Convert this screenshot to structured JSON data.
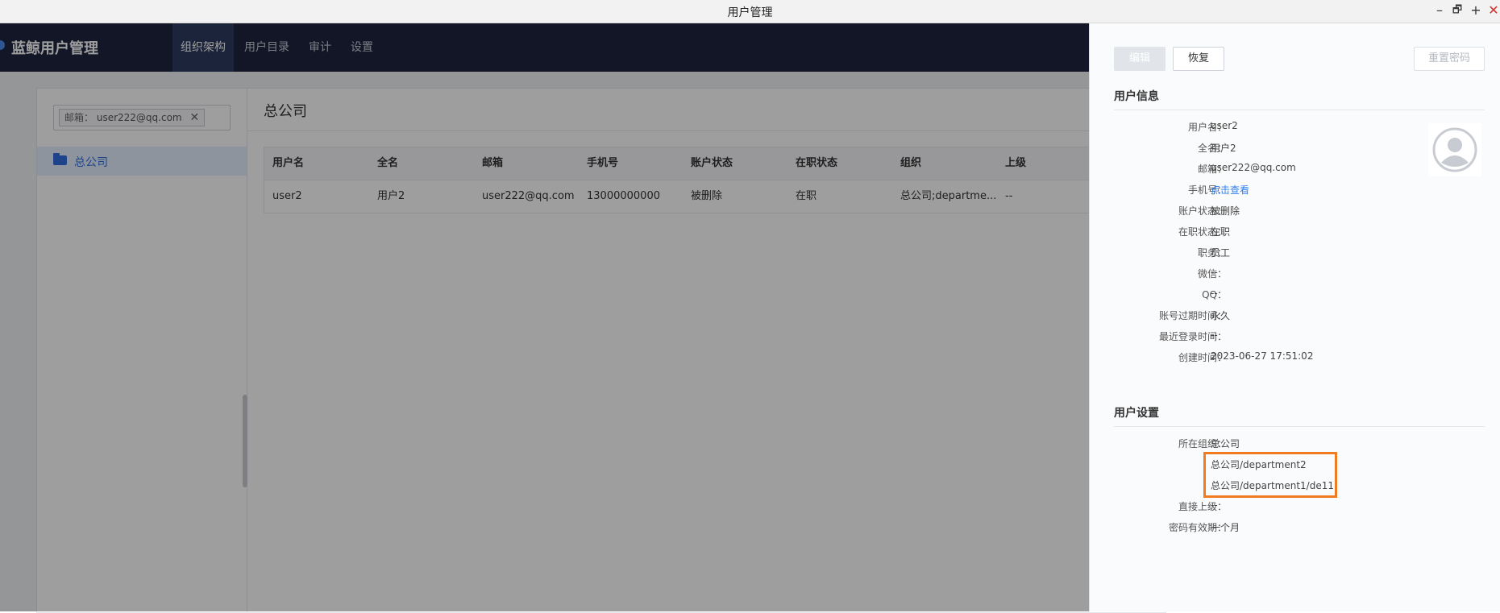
{
  "window": {
    "title": "用户管理",
    "controls": {
      "minimize": "–",
      "restore": "🗗",
      "maximize": "+",
      "close": "✕"
    }
  },
  "app": {
    "brand": "蓝鲸用户管理",
    "nav": [
      {
        "label": "组织架构",
        "active": true
      },
      {
        "label": "用户目录",
        "active": false
      },
      {
        "label": "审计",
        "active": false
      },
      {
        "label": "设置",
        "active": false
      }
    ],
    "search_tag": {
      "label": "邮箱：",
      "value": "user222@qq.com"
    },
    "tree": {
      "root": "总公司"
    },
    "main_title": "总公司",
    "table": {
      "headers": [
        "用户名",
        "全名",
        "邮箱",
        "手机号",
        "账户状态",
        "在职状态",
        "组织",
        "上级"
      ],
      "rows": [
        [
          "user2",
          "用户2",
          "user222@qq.com",
          "13000000000",
          "被删除",
          "在职",
          "总公司;departme...",
          "--"
        ]
      ]
    }
  },
  "drawer": {
    "buttons": {
      "edit": "编辑",
      "restore": "恢复",
      "reset_password": "重置密码"
    },
    "user_info_title": "用户信息",
    "user_info": [
      {
        "label": "用户名：",
        "value": "user2"
      },
      {
        "label": "全名：",
        "value": "用户2"
      },
      {
        "label": "邮箱：",
        "value": "user222@qq.com"
      },
      {
        "label": "手机号：",
        "value": "点击查看",
        "is_link": true
      },
      {
        "label": "账户状态：",
        "value": "被删除"
      },
      {
        "label": "在职状态：",
        "value": "在职"
      },
      {
        "label": "职务：",
        "value": "员工"
      },
      {
        "label": "微信：",
        "value": "--"
      },
      {
        "label": "QQ：",
        "value": "--"
      },
      {
        "label": "账号过期时间：",
        "value": "永久"
      },
      {
        "label": "最近登录时间：",
        "value": "--"
      },
      {
        "label": "创建时间：",
        "value": "2023-06-27 17:51:02"
      }
    ],
    "user_settings_title": "用户设置",
    "orgs_label": "所在组织：",
    "orgs": [
      "总公司",
      "总公司/department2",
      "总公司/department1/de11"
    ],
    "direct_leader_label": "直接上级：",
    "direct_leader_value": "--",
    "password_validity_label": "密码有效期：",
    "password_validity_value": "一个月"
  },
  "colors": {
    "accent": "#2f7ff0",
    "nav_bg": "#1d2540",
    "highlight": "#f07b20"
  }
}
